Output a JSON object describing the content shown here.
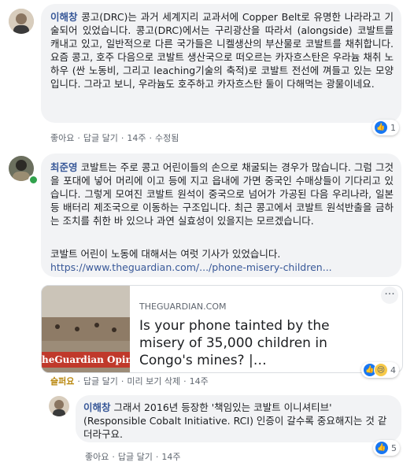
{
  "comment1": {
    "author": "이해창",
    "text": "콩고(DRC)는 과거 세계지리 교과서에 Copper Belt로 유명한 나라라고 기술되어 있었습니다. 콩고(DRC)에서는 구리광산을 따라서 (alongside) 코발트를 캐내고 있고, 일반적으로 다른 국가들은 니켈생산의 부산물로 코발트를 채취합니다. 요즘 콩고, 호주 다음으로 코발트 생산국으로 떠오르는 카자흐스탄은 우라늄 채취 노하우 (싼 노동비, 그리고 leaching기술의 축적)로 코발트 전선에 껴들고 있는 모양입니다. 그라고 보니, 우라늄도 호주하고 카자흐스탄 둘이 다해먹는 광물이네요.",
    "like": "좋아요",
    "reply": "답글 달기",
    "time": "14주",
    "edited": "수정됨",
    "reaction_count": "1"
  },
  "comment2": {
    "author": "최준영",
    "text": "코발트는 주로 콩고 어린이들의 손으로 채굴되는 경우가 많습니다. 그럼 그것을 포대에 넣어 머리에 이고 등에 지고 읍내에 가면 중국인 수매상들이 기다리고 있습니다. 그렇게 모여진 코발트 원석이 중국으로 넘어가 가공된 다음 우리나라, 일본 등 배터리 제조국으로 이동하는 구조입니다. 최근 콩고에서 코발트 원석반출을 금하는 조치를 취한 바 있으나 과연 실효성이 있을지는 모르겠습니다.",
    "text2": "코발트 어린이 노동에 대해서는 여럿 기사가 있었습니다.",
    "url": "https://www.theguardian.com/.../phone-misery-children...",
    "card_source": "THEGUARDIAN.COM",
    "card_title": "Is your phone tainted by the misery of 35,000 children in Congo's mines? |…",
    "card_thumb_text": "Guardian Opinions",
    "card_thumb_prefix": "he",
    "like": "슬퍼요",
    "reply": "답글 달기",
    "preview_delete": "미리 보기 삭제",
    "time": "14주",
    "reaction_count": "4",
    "more_icon": "ellipsis-icon"
  },
  "comment3": {
    "author": "이해창",
    "text": "그래서 2016년 등장한 '책임있는 코발트 이니셔티브' (Responsible Cobalt Initiative. RCI) 인증이 갈수록 중요해지는 것 같더라구요.",
    "like": "좋아요",
    "reply": "답글 달기",
    "time": "14주",
    "reaction_count": "5"
  },
  "colors": {
    "link": "#385898",
    "like_blue": "#1877f2",
    "sad_yellow": "#f7c948",
    "bubble": "#f2f3f5"
  }
}
